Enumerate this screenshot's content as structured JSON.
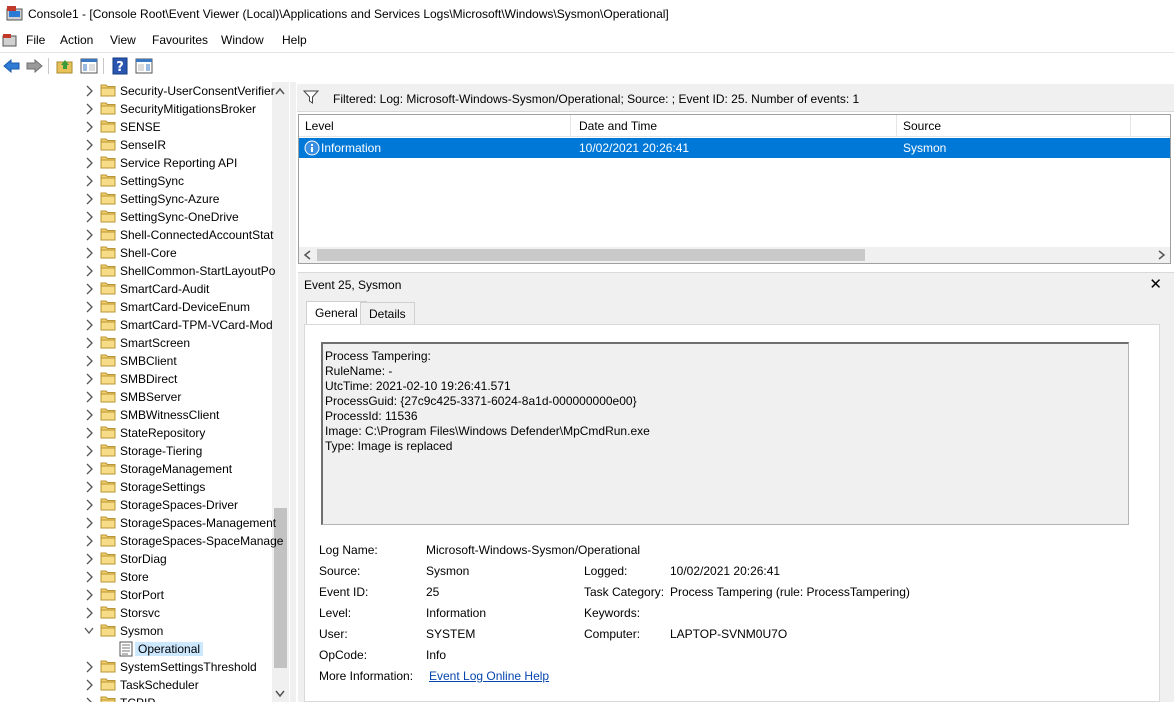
{
  "window": {
    "title": "Console1 - [Console Root\\Event Viewer (Local)\\Applications and Services Logs\\Microsoft\\Windows\\Sysmon\\Operational]"
  },
  "menu": [
    "File",
    "Action",
    "View",
    "Favourites",
    "Window",
    "Help"
  ],
  "toolbar": {
    "icons": [
      "back-arrow-icon",
      "forward-arrow-icon",
      "up-folder-icon",
      "show-hide-tree-icon",
      "help-icon",
      "show-hide-action-pane-icon"
    ]
  },
  "tree": {
    "items": [
      {
        "label": "Security-UserConsentVerifier",
        "expanded": false
      },
      {
        "label": "SecurityMitigationsBroker",
        "expanded": false
      },
      {
        "label": "SENSE",
        "expanded": false
      },
      {
        "label": "SenseIR",
        "expanded": false
      },
      {
        "label": "Service Reporting API",
        "expanded": false
      },
      {
        "label": "SettingSync",
        "expanded": false
      },
      {
        "label": "SettingSync-Azure",
        "expanded": false
      },
      {
        "label": "SettingSync-OneDrive",
        "expanded": false
      },
      {
        "label": "Shell-ConnectedAccountStat",
        "expanded": false
      },
      {
        "label": "Shell-Core",
        "expanded": false
      },
      {
        "label": "ShellCommon-StartLayoutPo",
        "expanded": false
      },
      {
        "label": "SmartCard-Audit",
        "expanded": false
      },
      {
        "label": "SmartCard-DeviceEnum",
        "expanded": false
      },
      {
        "label": "SmartCard-TPM-VCard-Mod",
        "expanded": false
      },
      {
        "label": "SmartScreen",
        "expanded": false
      },
      {
        "label": "SMBClient",
        "expanded": false
      },
      {
        "label": "SMBDirect",
        "expanded": false
      },
      {
        "label": "SMBServer",
        "expanded": false
      },
      {
        "label": "SMBWitnessClient",
        "expanded": false
      },
      {
        "label": "StateRepository",
        "expanded": false
      },
      {
        "label": "Storage-Tiering",
        "expanded": false
      },
      {
        "label": "StorageManagement",
        "expanded": false
      },
      {
        "label": "StorageSettings",
        "expanded": false
      },
      {
        "label": "StorageSpaces-Driver",
        "expanded": false
      },
      {
        "label": "StorageSpaces-Management",
        "expanded": false
      },
      {
        "label": "StorageSpaces-SpaceManage",
        "expanded": false
      },
      {
        "label": "StorDiag",
        "expanded": false
      },
      {
        "label": "Store",
        "expanded": false
      },
      {
        "label": "StorPort",
        "expanded": false
      },
      {
        "label": "Storsvc",
        "expanded": false
      },
      {
        "label": "Sysmon",
        "expanded": true
      },
      {
        "label": "Operational",
        "child": true,
        "selected": true
      },
      {
        "label": "SystemSettingsThreshold",
        "expanded": false
      },
      {
        "label": "TaskScheduler",
        "expanded": false
      },
      {
        "label": "TCPIP",
        "expanded": false
      }
    ]
  },
  "filter": {
    "text": "Filtered: Log: Microsoft-Windows-Sysmon/Operational; Source: ; Event ID: 25. Number of events: 1"
  },
  "grid": {
    "columns": [
      "Level",
      "Date and Time",
      "Source"
    ],
    "rows": [
      {
        "level": "Information",
        "datetime": "10/02/2021 20:26:41",
        "source": "Sysmon"
      }
    ]
  },
  "detail": {
    "title": "Event 25, Sysmon",
    "tabs": [
      "General",
      "Details"
    ],
    "description": [
      "Process Tampering:",
      "RuleName: -",
      "UtcTime: 2021-02-10 19:26:41.571",
      "ProcessGuid: {27c9c425-3371-6024-8a1d-000000000e00}",
      "ProcessId: 11536",
      "Image: C:\\Program Files\\Windows Defender\\MpCmdRun.exe",
      "Type: Image is replaced"
    ],
    "fields": {
      "log_name_label": "Log Name:",
      "log_name": "Microsoft-Windows-Sysmon/Operational",
      "source_label": "Source:",
      "source": "Sysmon",
      "logged_label": "Logged:",
      "logged": "10/02/2021 20:26:41",
      "event_id_label": "Event ID:",
      "event_id": "25",
      "task_category_label": "Task Category:",
      "task_category": "Process Tampering (rule: ProcessTampering)",
      "level_label": "Level:",
      "level": "Information",
      "keywords_label": "Keywords:",
      "keywords": "",
      "user_label": "User:",
      "user": "SYSTEM",
      "computer_label": "Computer:",
      "computer": "LAPTOP-SVNM0U7O",
      "opcode_label": "OpCode:",
      "opcode": "Info",
      "more_info_label": "More Information:",
      "more_info_link": "Event Log Online Help"
    }
  },
  "colors": {
    "selection": "#0078d7",
    "tree_selection": "#cce8ff",
    "folder": "#e8c15b",
    "link": "#0645ad"
  }
}
